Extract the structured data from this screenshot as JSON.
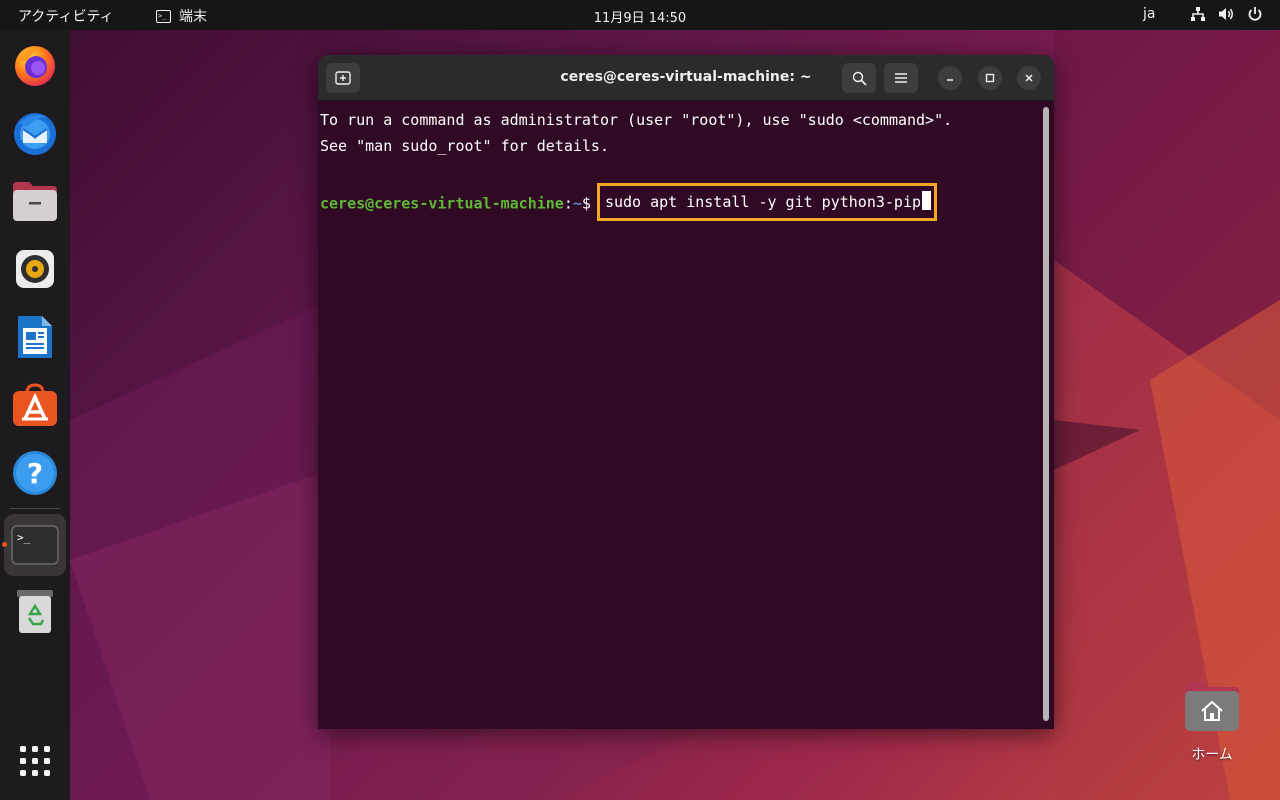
{
  "topbar": {
    "activities": "アクティビティ",
    "app_name": "端末",
    "clock": "11月9日  14:50",
    "language": "ja"
  },
  "dock": {
    "items": [
      {
        "name": "firefox",
        "icon": "firefox-icon"
      },
      {
        "name": "thunderbird",
        "icon": "thunderbird-icon"
      },
      {
        "name": "files",
        "icon": "files-icon"
      },
      {
        "name": "rhythmbox",
        "icon": "rhythmbox-icon"
      },
      {
        "name": "libreoffice-writer",
        "icon": "writer-icon"
      },
      {
        "name": "app-center",
        "icon": "app-center-icon"
      },
      {
        "name": "help",
        "icon": "help-icon"
      },
      {
        "name": "terminal",
        "icon": "terminal-icon",
        "running": true
      },
      {
        "name": "trash",
        "icon": "trash-icon"
      }
    ],
    "show_apps_icon": "app-grid-icon"
  },
  "window": {
    "title": "ceres@ceres-virtual-machine: ~",
    "terminal": {
      "line1": "To run a command as administrator (user \"root\"), use \"sudo <command>\".",
      "line2": "See \"man sudo_root\" for details.",
      "prompt_user": "ceres@ceres-virtual-machine",
      "prompt_colon": ":",
      "prompt_path": "~",
      "prompt_dollar": "$",
      "command": "sudo apt install -y git python3-pip"
    }
  },
  "desktop": {
    "home_label": "ホーム"
  },
  "colors": {
    "terminal_bg": "#300a24",
    "prompt_green": "#5fb835",
    "prompt_blue": "#5c86c9",
    "highlight": "#f5a623",
    "accent": "#e95420"
  }
}
